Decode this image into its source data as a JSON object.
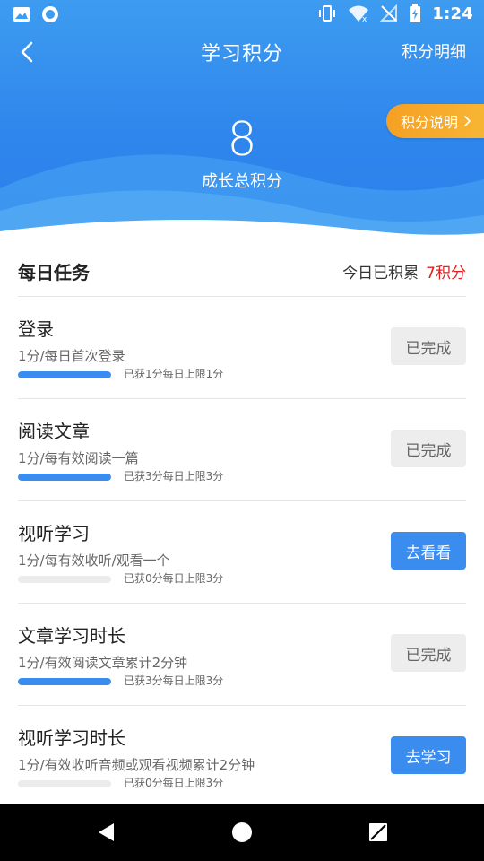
{
  "statusbar": {
    "time": "1:24"
  },
  "topbar": {
    "title": "学习积分",
    "detail_link": "积分明细"
  },
  "score": {
    "value": "8",
    "label": "成长总积分",
    "explain_button": "积分说明"
  },
  "daily": {
    "title": "每日任务",
    "today_label": "今日已积累",
    "today_points": "7积分"
  },
  "tasks": [
    {
      "name": "登录",
      "desc": "1分/每日首次登录",
      "progress_text": "已获1分每日上限1分",
      "progress": 1.0,
      "button": "已完成",
      "status": "done"
    },
    {
      "name": "阅读文章",
      "desc": "1分/每有效阅读一篇",
      "progress_text": "已获3分每日上限3分",
      "progress": 1.0,
      "button": "已完成",
      "status": "done"
    },
    {
      "name": "视听学习",
      "desc": "1分/每有效收听/观看一个",
      "progress_text": "已获0分每日上限3分",
      "progress": 0.0,
      "button": "去看看",
      "status": "todo"
    },
    {
      "name": "文章学习时长",
      "desc": "1分/有效阅读文章累计2分钟",
      "progress_text": "已获3分每日上限3分",
      "progress": 1.0,
      "button": "已完成",
      "status": "done"
    },
    {
      "name": "视听学习时长",
      "desc": "1分/有效收听音频或观看视频累计2分钟",
      "progress_text": "已获0分每日上限3分",
      "progress": 0.0,
      "button": "去学习",
      "status": "todo"
    }
  ],
  "colors": {
    "primary": "#3a8cef",
    "header_top": "#3d9cf0",
    "accent_orange": "#f6a023",
    "points_red": "#e02020",
    "done_bg": "#ededed"
  },
  "icons": {
    "status_left": [
      "image-icon",
      "circle-app-icon"
    ],
    "status_right": [
      "vibrate-icon",
      "wifi-icon",
      "no-signal-icon",
      "battery-icon"
    ],
    "nav": [
      "back-triangle-icon",
      "home-circle-icon",
      "recents-square-icon"
    ]
  }
}
